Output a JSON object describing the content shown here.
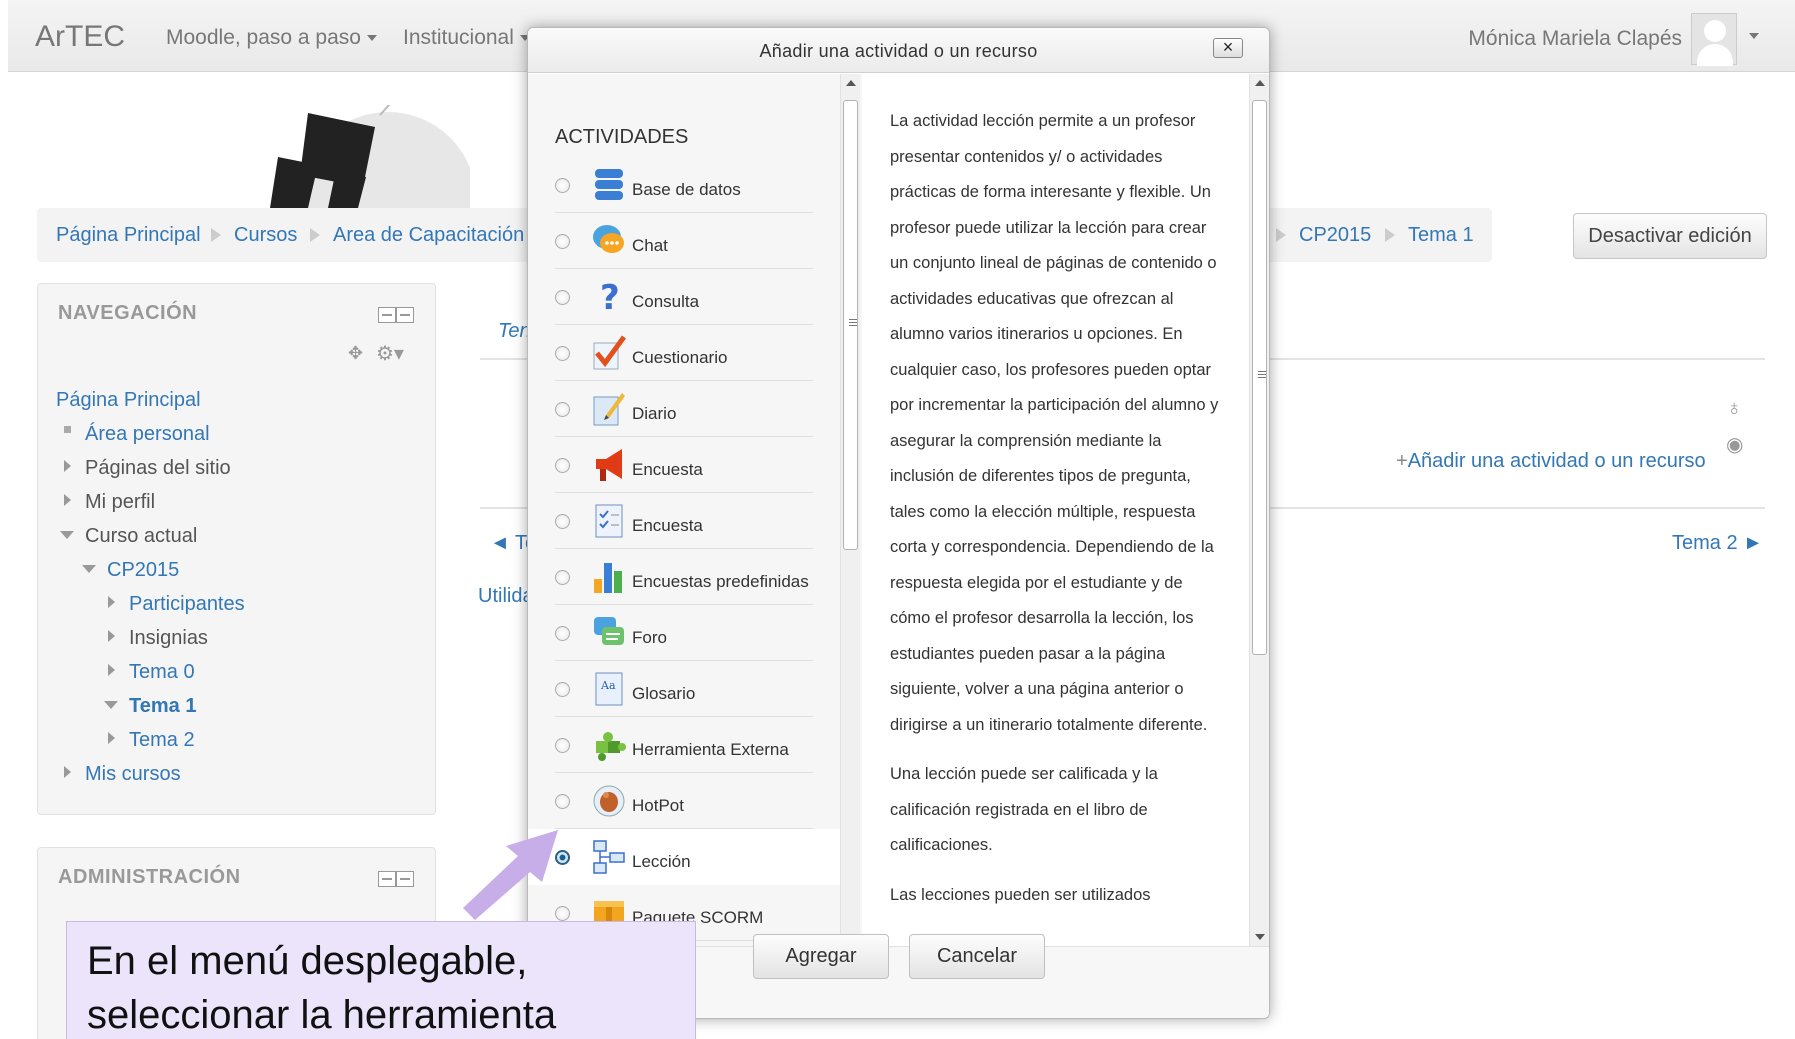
{
  "navbar": {
    "brand": "ArTEC",
    "menu1": "Moodle, paso a paso",
    "menu2": "Institucional",
    "user": "Mónica Mariela Clapés"
  },
  "breadcrumb": {
    "items": [
      "Página Principal",
      "Cursos",
      "Area de Capacitación"
    ],
    "tail": [
      "CP2015",
      "Tema 1"
    ]
  },
  "edit_button": "Desactivar edición",
  "nav_block": {
    "title": "NAVEGACIÓN",
    "items": [
      "Página Principal",
      "Área personal",
      "Páginas del sitio",
      "Mi perfil",
      "Curso actual",
      "CP2015",
      "Participantes",
      "Insignias",
      "Tema 0",
      "Tema 1",
      "Tema 2",
      "Mis cursos"
    ]
  },
  "admin_block": {
    "title": "ADMINISTRACIÓN"
  },
  "main": {
    "section_tab": "Ten",
    "prev_link": "◄ Te",
    "utilities": "Utilida",
    "add_activity": "Añadir una actividad o un recurso",
    "next_link": "Tema 2 ►"
  },
  "modal": {
    "title": "Añadir una actividad o un recurso",
    "close": "×",
    "section_header": "ACTIVIDADES",
    "options": [
      {
        "label": "Base de datos",
        "icon": "database-icon"
      },
      {
        "label": "Chat",
        "icon": "chat-icon"
      },
      {
        "label": "Consulta",
        "icon": "question-icon"
      },
      {
        "label": "Cuestionario",
        "icon": "checkmark-icon"
      },
      {
        "label": "Diario",
        "icon": "journal-icon"
      },
      {
        "label": "Encuesta",
        "icon": "megaphone-icon"
      },
      {
        "label": "Encuesta",
        "icon": "survey-icon"
      },
      {
        "label": "Encuestas predefinidas",
        "icon": "bar-chart-icon"
      },
      {
        "label": "Foro",
        "icon": "forum-icon"
      },
      {
        "label": "Glosario",
        "icon": "glossary-icon"
      },
      {
        "label": "Herramienta Externa",
        "icon": "puzzle-icon"
      },
      {
        "label": "HotPot",
        "icon": "hotpot-icon"
      },
      {
        "label": "Lección",
        "icon": "lesson-icon",
        "selected": true
      },
      {
        "label": "Paquete SCORM",
        "icon": "package-icon"
      }
    ],
    "description": [
      "La actividad lección permite a un profesor presentar contenidos y/ o actividades prácticas de forma interesante y flexible. Un profesor puede utilizar la lección para crear un conjunto lineal de páginas de contenido o actividades educativas que ofrezcan al alumno varios itinerarios u opciones. En cualquier caso, los profesores pueden optar por incrementar la participación del alumno y asegurar la comprensión mediante la inclusión de diferentes tipos de pregunta, tales como la elección múltiple, respuesta corta y correspondencia. Dependiendo de la respuesta elegida por el estudiante y de cómo el profesor desarrolla la lección, los estudiantes pueden pasar a la página siguiente, volver a una página anterior o dirigirse a un itinerario totalmente diferente.",
      "Una lección puede ser calificada y la calificación registrada en el libro de calificaciones.",
      "Las lecciones pueden ser utilizados"
    ],
    "add_button": "Agregar",
    "cancel_button": "Cancelar"
  },
  "callout": {
    "line1": "En el menú desplegable,",
    "line2": "seleccionar la herramienta"
  }
}
